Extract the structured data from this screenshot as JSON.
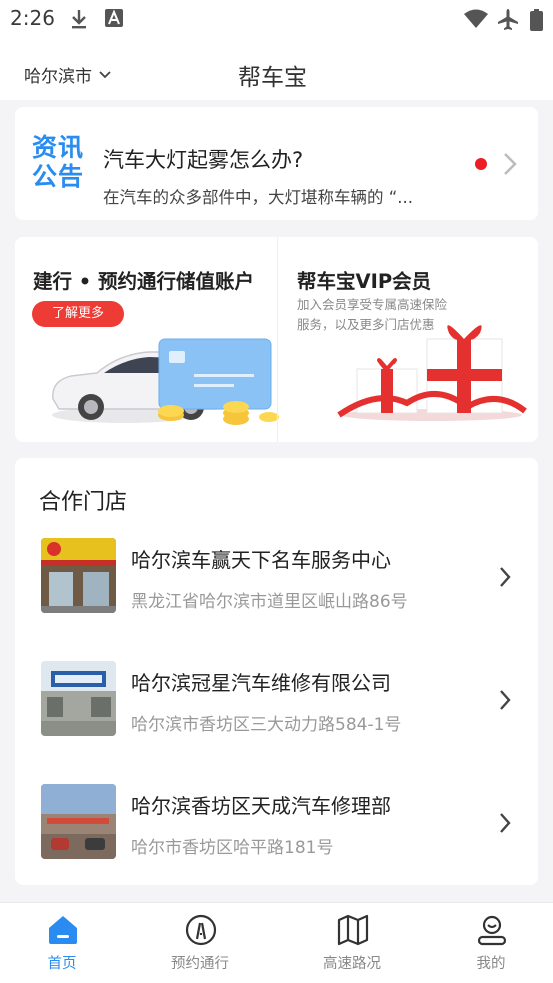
{
  "status_bar": {
    "time": "2:26",
    "icons": [
      "download-icon",
      "font-icon",
      "wifi-icon",
      "airplane-icon",
      "battery-icon"
    ]
  },
  "header": {
    "city": "哈尔滨市",
    "title": "帮车宝"
  },
  "news": {
    "logo_line1": "资讯",
    "logo_line2": "公告",
    "title": "汽车大灯起雾怎么办?",
    "summary": "在汽车的众多部件中，大灯堪称车辆的 “...",
    "unread_color": "#ee1c25"
  },
  "promo": {
    "left_title": "建行 • 预约通行储值账户",
    "left_button": "了解更多",
    "right_title": "帮车宝VIP会员",
    "right_desc": "加入会员享受专属高速保险服务，以及更多门店优惠"
  },
  "stores": {
    "title": "合作门店",
    "items": [
      {
        "name": "哈尔滨车赢天下名车服务中心",
        "address": "黑龙江省哈尔滨市道里区岷山路86号"
      },
      {
        "name": "哈尔滨冠星汽车维修有限公司",
        "address": "哈尔滨市香坊区三大动力路584-1号"
      },
      {
        "name": "哈尔滨香坊区天成汽车修理部",
        "address": "哈尔市香坊区哈平路181号"
      }
    ]
  },
  "tabbar": {
    "items": [
      {
        "label": "首页",
        "icon": "home-icon",
        "active": true
      },
      {
        "label": "预约通行",
        "icon": "road-icon",
        "active": false
      },
      {
        "label": "高速路况",
        "icon": "map-icon",
        "active": false
      },
      {
        "label": "我的",
        "icon": "profile-icon",
        "active": false
      }
    ]
  },
  "colors": {
    "accent": "#2a8cf0",
    "button_red": "#ee3b36",
    "background": "#f4f4f6"
  }
}
